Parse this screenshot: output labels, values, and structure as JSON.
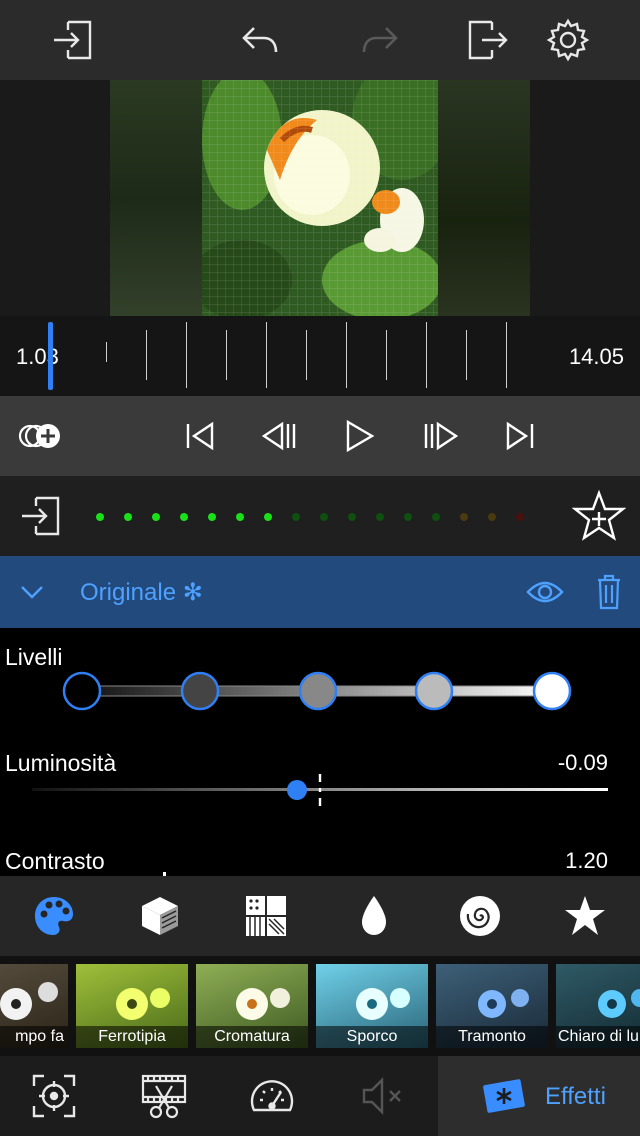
{
  "toolbar": {
    "icons": [
      "import-icon",
      "undo-icon",
      "redo-icon",
      "export-icon",
      "settings-icon"
    ]
  },
  "timeline": {
    "start_time": "1.03",
    "end_time": "14.05",
    "playhead_color": "#2f7ff5"
  },
  "transport": {
    "icons": [
      "add-layer-icon",
      "skip-to-start-icon",
      "step-back-icon",
      "play-icon",
      "step-forward-icon",
      "skip-to-end-icon"
    ]
  },
  "meter": {
    "level_dots": 16,
    "lit_dots": 7,
    "colors": {
      "on": "#19e019",
      "off_green": "#0f4f0f",
      "off_amber": "#4a3a10",
      "off_red": "#4a1010"
    }
  },
  "effect": {
    "name": "Originale ✻",
    "accent": "#4ea1ff",
    "header_bg": "#234a7d"
  },
  "params": {
    "levels_label": "Livelli",
    "brightness_label": "Luminosità",
    "brightness_value": "-0.09",
    "brightness_fraction": 0.46,
    "contrast_label": "Contrasto",
    "contrast_value": "1.20"
  },
  "categories": [
    "palette-icon",
    "cube-icon",
    "pattern-icon",
    "drop-icon",
    "spiral-icon",
    "star-icon"
  ],
  "filters": [
    {
      "label": "mpo fa"
    },
    {
      "label": "Ferrotipia"
    },
    {
      "label": "Cromatura"
    },
    {
      "label": "Sporco"
    },
    {
      "label": "Tramonto"
    },
    {
      "label": "Chiaro di lu"
    }
  ],
  "bottom_nav": {
    "effects_label": "Effetti"
  }
}
